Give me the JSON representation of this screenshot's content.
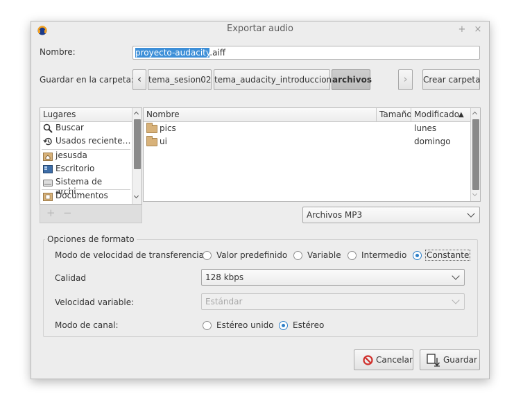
{
  "window": {
    "title": "Exportar audio",
    "btn_min": "+",
    "btn_close": "×"
  },
  "name_row": {
    "label": "Nombre:",
    "value_selected": "proyecto-audacity",
    "value_rest": ".aiff"
  },
  "folder_row": {
    "label": "Guardar en la carpeta:",
    "back": "‹",
    "forward": "›",
    "crumbs": [
      "tema_sesion02",
      "tema_audacity_introduccion",
      "archivos"
    ],
    "create_folder": "Crear carpeta"
  },
  "places": {
    "header": "Lugares",
    "items": [
      {
        "label": "Buscar",
        "icon": "search-icon"
      },
      {
        "label": "Usados reciente…",
        "icon": "recent-icon"
      },
      {
        "label": "jesusda",
        "icon": "home-folder-icon"
      },
      {
        "label": "Escritorio",
        "icon": "desktop-icon"
      },
      {
        "label": "Sistema de archi…",
        "icon": "drive-icon"
      },
      {
        "label": "Documentos",
        "icon": "folder-icon"
      }
    ],
    "add": "+",
    "remove": "−"
  },
  "files": {
    "col_name": "Nombre",
    "col_size": "Tamaño",
    "col_modified": "Modificado",
    "sort_indicator": "▲",
    "rows": [
      {
        "name": "pics",
        "size": "",
        "modified": "lunes"
      },
      {
        "name": "ui",
        "size": "",
        "modified": "domingo"
      }
    ]
  },
  "filter": {
    "value": "Archivos MP3"
  },
  "format": {
    "group_title": "Opciones de formato",
    "mode_label": "Modo de velocidad de transferencia:",
    "mode_options": [
      "Valor predefinido",
      "Variable",
      "Intermedio",
      "Constante"
    ],
    "mode_selected": "Constante",
    "quality_label": "Calidad",
    "quality_value": "128 kbps",
    "variable_label": "Velocidad variable:",
    "variable_value": "Estándar",
    "channel_label": "Modo de canal:",
    "channel_options": [
      "Estéreo unido",
      "Estéreo"
    ],
    "channel_selected": "Estéreo"
  },
  "actions": {
    "cancel": "Cancelar",
    "save": "Guardar"
  },
  "colors": {
    "selection": "#3d8fd8",
    "accent": "#2f80c8",
    "cancel_red": "#d0312d"
  }
}
